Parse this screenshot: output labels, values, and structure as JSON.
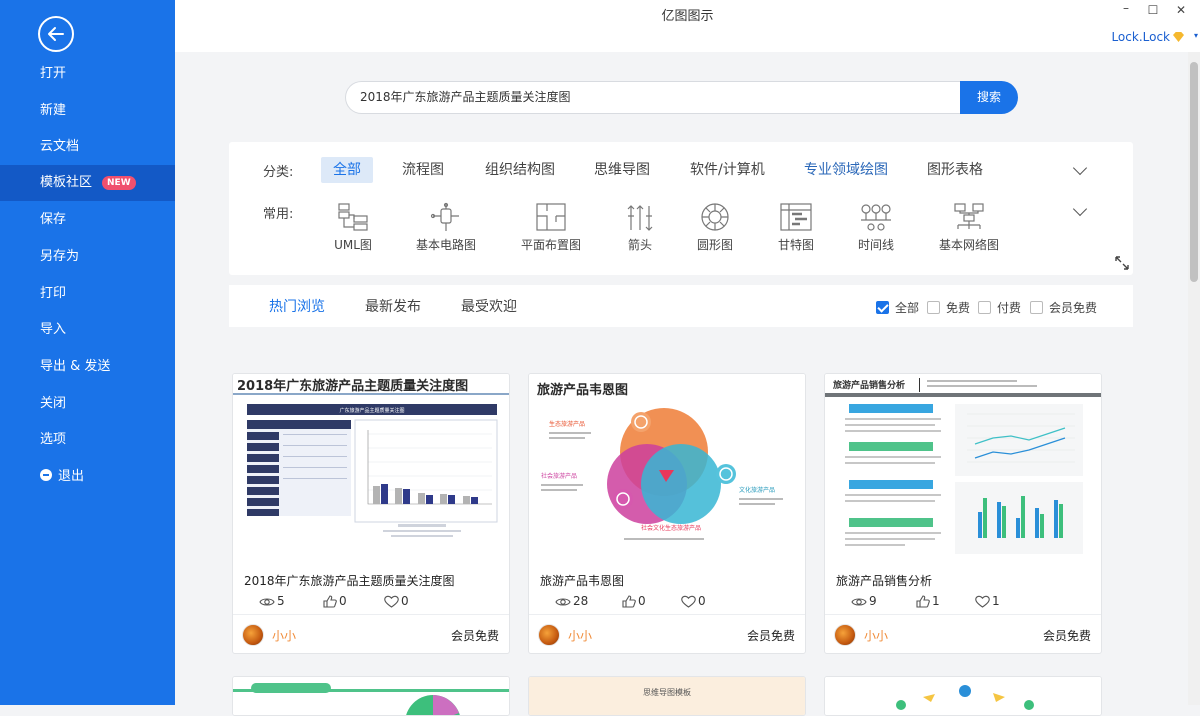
{
  "app": {
    "title": "亿图图示",
    "user": "Lock.Lock"
  },
  "sidebar": {
    "items": [
      {
        "label": "打开"
      },
      {
        "label": "新建"
      },
      {
        "label": "云文档"
      },
      {
        "label": "模板社区",
        "badge": "NEW",
        "active": true
      },
      {
        "label": "保存"
      },
      {
        "label": "另存为"
      },
      {
        "label": "打印"
      },
      {
        "label": "导入"
      },
      {
        "label": "导出 & 发送"
      },
      {
        "label": "关闭"
      },
      {
        "label": "选项"
      },
      {
        "label": "退出"
      }
    ]
  },
  "search": {
    "value": "2018年广东旅游产品主题质量关注度图",
    "button": "搜索"
  },
  "categories": {
    "label": "分类:",
    "tabs": [
      "全部",
      "流程图",
      "组织结构图",
      "思维导图",
      "软件/计算机",
      "专业领域绘图",
      "图形表格"
    ],
    "active": "全部"
  },
  "common": {
    "label": "常用:",
    "items": [
      "UML图",
      "基本电路图",
      "平面布置图",
      "箭头",
      "圆形图",
      "甘特图",
      "时间线",
      "基本网络图"
    ]
  },
  "sort": {
    "tabs": [
      "热门浏览",
      "最新发布",
      "最受欢迎"
    ],
    "active": "热门浏览",
    "filters": [
      {
        "label": "全部",
        "checked": true
      },
      {
        "label": "免费",
        "checked": false
      },
      {
        "label": "付费",
        "checked": false
      },
      {
        "label": "会员免费",
        "checked": false
      }
    ]
  },
  "cards": [
    {
      "title": "2018年广东旅游产品主题质量关注度图",
      "views": "5",
      "likes": "0",
      "favs": "0",
      "author": "小小",
      "price": "会员免费",
      "thumb_title": "2018年广东旅游产品主题质量关注度图",
      "thumb_subtitle": "广东旅游产品主题质量关注图"
    },
    {
      "title": "旅游产品韦恩图",
      "views": "28",
      "likes": "0",
      "favs": "0",
      "author": "小小",
      "price": "会员免费",
      "thumb_title": "旅游产品韦恩图",
      "venn_labels": [
        "生态旅游产品",
        "社会旅游产品",
        "文化旅游产品",
        "社会文化生态旅游产品"
      ]
    },
    {
      "title": "旅游产品销售分析",
      "views": "9",
      "likes": "1",
      "favs": "1",
      "author": "小小",
      "price": "会员免费",
      "thumb_title": "旅游产品销售分析"
    }
  ],
  "cards_row2": [
    {
      "thumb_title": ""
    },
    {
      "thumb_title": "思维导图模板"
    },
    {
      "thumb_title": ""
    }
  ],
  "colors": {
    "sidebar": "#1a73e8",
    "accent": "#1a73e8",
    "badge": "#f0506e",
    "author": "#f08c3a"
  }
}
